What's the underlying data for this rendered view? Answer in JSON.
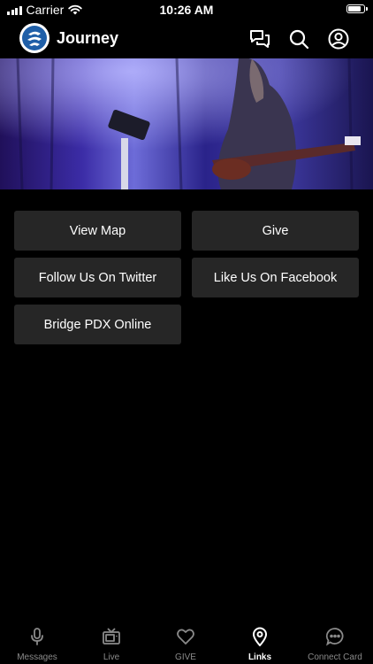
{
  "status_bar": {
    "carrier": "Carrier",
    "time": "10:26 AM",
    "battery_level": 0.9
  },
  "header": {
    "title": "Journey",
    "logo_icon": "church-logo",
    "actions": [
      {
        "name": "chat-icon"
      },
      {
        "name": "search-icon"
      },
      {
        "name": "profile-icon"
      }
    ]
  },
  "links": [
    {
      "label": "View Map"
    },
    {
      "label": "Give"
    },
    {
      "label": "Follow Us On Twitter"
    },
    {
      "label": "Like Us On Facebook"
    },
    {
      "label": "Bridge PDX Online"
    }
  ],
  "tabs": [
    {
      "label": "Messages",
      "icon": "microphone-icon",
      "active": false
    },
    {
      "label": "Live",
      "icon": "tv-icon",
      "active": false
    },
    {
      "label": "GIVE",
      "icon": "heart-icon",
      "active": false
    },
    {
      "label": "Links",
      "icon": "location-pin-icon",
      "active": true
    },
    {
      "label": "Connect Card",
      "icon": "chat-bubble-icon",
      "active": false
    }
  ],
  "colors": {
    "background": "#000000",
    "button_bg": "#262626",
    "tab_inactive": "#8a8a8a",
    "tab_active": "#ffffff",
    "logo_blue": "#1f5fa8"
  }
}
